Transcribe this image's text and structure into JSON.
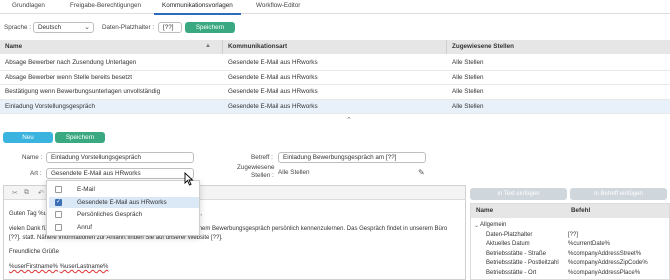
{
  "tabs": [
    "Grundlagen",
    "Freigabe-Berechtigungen",
    "Kommunikationsvorlagen",
    "Workflow-Editor"
  ],
  "lang_row": {
    "sprache_label": "Sprache :",
    "sprache_value": "Deutsch",
    "platzhalter_label": "Daten-Platzhalter :",
    "platzhalter_value": "[??]",
    "save_label": "Speichern"
  },
  "table": {
    "headers": [
      "Name",
      "Kommunikationsart",
      "Zugewiesene Stellen"
    ],
    "rows": [
      [
        "Absage Bewerber nach Zusendung Unterlagen",
        "Gesendete E-Mail aus HRworks",
        "Alle Stellen"
      ],
      [
        "Absage Bewerber wenn Stelle bereits besetzt",
        "Gesendete E-Mail aus HRworks",
        "Alle Stellen"
      ],
      [
        "Bestätigung wenn Bewerbungsunterlagen unvollständig",
        "Gesendete E-Mail aus HRworks",
        "Alle Stellen"
      ],
      [
        "Einladung Vorstellungsgespräch",
        "Gesendete E-Mail aus HRworks",
        "Alle Stellen"
      ]
    ]
  },
  "actions": {
    "new_label": "Neu",
    "save_label": "Speichern"
  },
  "form": {
    "name_label": "Name :",
    "name_value": "Einladung Vorstellungsgespräch",
    "art_label": "Art :",
    "art_value": "Gesendete E-Mail aus HRworks",
    "betreff_label": "Betreff :",
    "betreff_value": "Einladung Bewerbungsgespräch am [??]",
    "stellen_label_1": "Zugewiesene",
    "stellen_label_2": "Stellen :",
    "stellen_value": "Alle Stellen"
  },
  "dropdown": {
    "options": [
      {
        "label": "E-Mail",
        "checked": false
      },
      {
        "label": "Gesendete E-Mail aus HRworks",
        "checked": true
      },
      {
        "label": "Persönliches Gespräch",
        "checked": false
      },
      {
        "label": "Anruf",
        "checked": false
      }
    ]
  },
  "editor": {
    "line1_a": "Guten Tag %u",
    "line1_b": "%,",
    "line2_a": "vielen Dank fü",
    "line2_b": ") in einem Bewerbungsgespräch persönlich kennenzulernen. Das Gespräch findet in unserem Büro",
    "line3": "[??]. statt. Nähere Informationen zur Anfahrt finden Sie auf unserer Website [??].",
    "line4": "Freundliche Grüße",
    "sig_first": "%userFirstname%",
    "sig_last": "%userLastname%"
  },
  "right_panel": {
    "btn_insert_text": "in Text einfügen",
    "btn_insert_subject": "in Betreff einfügen",
    "headers": [
      "Name",
      "Befehl"
    ],
    "group": "Allgemein",
    "rows": [
      [
        "Daten-Platzhalter",
        "[??]"
      ],
      [
        "Aktuelles Datum",
        "%currentDate%"
      ],
      [
        "Betriebsstätte - Straße",
        "%companyAddressStreet%"
      ],
      [
        "Betriebsstätte - Postleitzahl",
        "%companyAddressZipCode%"
      ],
      [
        "Betriebsstätte - Ort",
        "%companyAddressPlace%"
      ]
    ]
  }
}
